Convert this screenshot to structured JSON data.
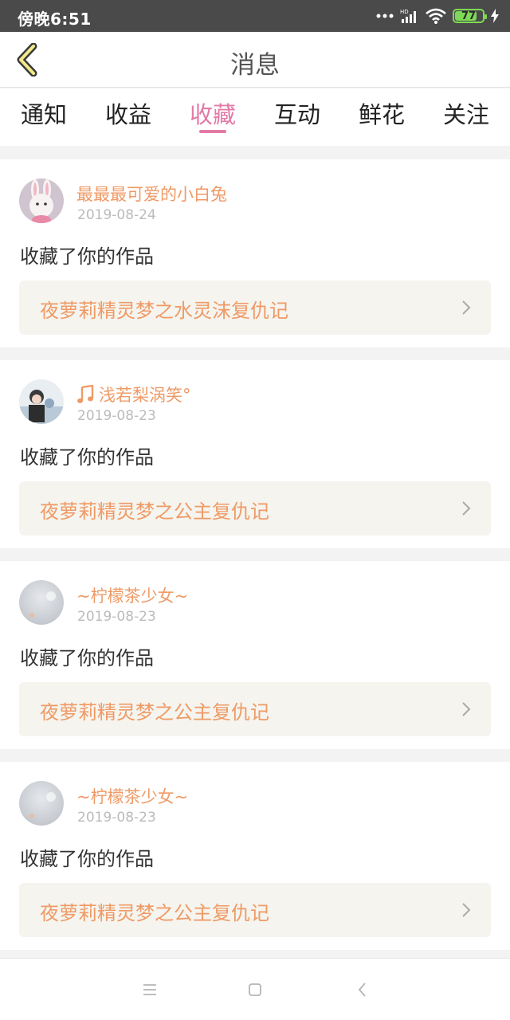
{
  "status_bar": {
    "time": "傍晚6:51",
    "battery": "77"
  },
  "header": {
    "title": "消息",
    "back_icon": "chevron-left-icon"
  },
  "tabs": [
    {
      "label": "通知",
      "active": false
    },
    {
      "label": "收益",
      "active": false
    },
    {
      "label": "收藏",
      "active": true
    },
    {
      "label": "互动",
      "active": false
    },
    {
      "label": "鲜花",
      "active": false
    },
    {
      "label": "关注",
      "active": false
    }
  ],
  "items": [
    {
      "username": "最最最可爱的小白兔",
      "date": "2019-08-24",
      "action": "收藏了你的作品",
      "work_title": "夜萝莉精灵梦之水灵沫复仇记",
      "avatar_icon": "bunny-avatar"
    },
    {
      "username": "浅若梨涡笑°",
      "date": "2019-08-23",
      "action": "收藏了你的作品",
      "work_title": "夜萝莉精灵梦之公主复仇记",
      "avatar_icon": "person-avatar",
      "badge_icon": "music-note-icon"
    },
    {
      "username": "~柠檬茶少女~",
      "date": "2019-08-23",
      "action": "收藏了你的作品",
      "work_title": "夜萝莉精灵梦之公主复仇记",
      "avatar_icon": "blur-avatar"
    },
    {
      "username": "~柠檬茶少女~",
      "date": "2019-08-23",
      "action": "收藏了你的作品",
      "work_title": "夜萝莉精灵梦之公主复仇记",
      "avatar_icon": "blur-avatar"
    }
  ],
  "colors": {
    "accent_pink": "#e27aa6",
    "accent_orange": "#ef9a66",
    "card_box": "#f5f4ee"
  }
}
